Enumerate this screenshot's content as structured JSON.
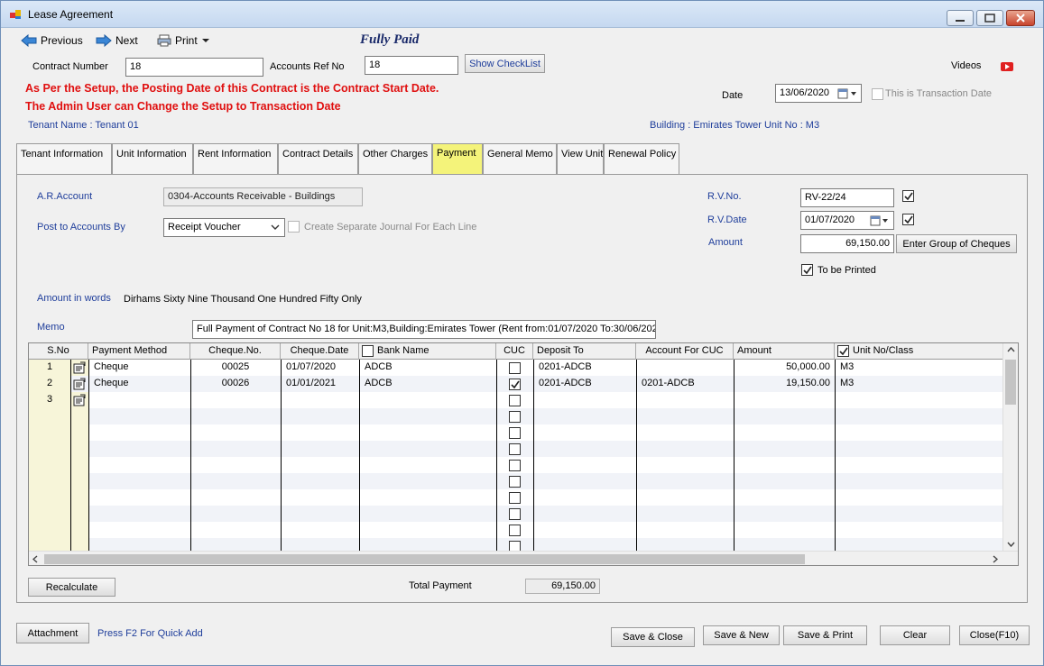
{
  "window": {
    "title": "Lease Agreement"
  },
  "toolbar": {
    "previous": "Previous",
    "next": "Next",
    "print": "Print",
    "status": "Fully Paid"
  },
  "header": {
    "contract_number_label": "Contract Number",
    "contract_number": "18",
    "accounts_ref_label": "Accounts Ref No",
    "accounts_ref": "18",
    "checklist_button": "Show CheckList",
    "videos": "Videos",
    "warning_line1": "As Per the Setup, the Posting Date of this Contract is the Contract Start Date.",
    "warning_line2": "The Admin User can Change the Setup to Transaction Date",
    "date_label": "Date",
    "date": "13/06/2020",
    "transaction_date_label": "This is Transaction Date",
    "tenant": "Tenant Name : Tenant 01",
    "building": "Building : Emirates Tower  Unit No : M3"
  },
  "tabs": [
    "Tenant Information",
    "Unit Information",
    "Rent Information",
    "Contract Details",
    "Other Charges",
    "Payment",
    "General Memo",
    "View Unit",
    "Renewal Policy"
  ],
  "payment": {
    "ar_account_label": "A.R.Account",
    "ar_account": "0304-Accounts Receivable - Buildings",
    "post_by_label": "Post to Accounts By",
    "post_by": "Receipt Voucher",
    "separate_journal_label": "Create Separate Journal For Each Line",
    "rv_no_label": "R.V.No.",
    "rv_no": "RV-22/24",
    "rv_date_label": "R.V.Date",
    "rv_date": "01/07/2020",
    "amount_label": "Amount",
    "amount": "69,150.00",
    "cheques_button": "Enter Group of Cheques",
    "to_be_printed_label": "To be Printed",
    "amount_words_label": "Amount in words",
    "amount_words": "Dirhams  Sixty Nine Thousand  One Hundred  Fifty Only",
    "memo_label": "Memo",
    "memo": "Full Payment of Contract No 18 for Unit:M3,Building:Emirates Tower (Rent from:01/07/2020 To:30/06/202",
    "recalculate": "Recalculate",
    "total_payment_label": "Total Payment",
    "total_payment": "69,150.00"
  },
  "grid": {
    "columns": [
      "S.No",
      "Payment Method",
      "Cheque.No.",
      "Cheque.Date",
      "Bank Name",
      "CUC",
      "Deposit To",
      "Account For CUC",
      "Amount",
      "Unit No/Class"
    ],
    "rows": [
      {
        "sno": "1",
        "method": "Cheque",
        "cheque_no": "00025",
        "cheque_date": "01/07/2020",
        "bank": "ADCB",
        "cuc": false,
        "deposit_to": "0201-ADCB",
        "account_cuc": "",
        "amount": "50,000.00",
        "unit": "M3"
      },
      {
        "sno": "2",
        "method": "Cheque",
        "cheque_no": "00026",
        "cheque_date": "01/01/2021",
        "bank": "ADCB",
        "cuc": true,
        "deposit_to": "0201-ADCB",
        "account_cuc": "0201-ADCB",
        "amount": "19,150.00",
        "unit": "M3"
      },
      {
        "sno": "3",
        "method": "",
        "cheque_no": "",
        "cheque_date": "",
        "bank": "",
        "cuc": false,
        "deposit_to": "",
        "account_cuc": "",
        "amount": "",
        "unit": ""
      }
    ]
  },
  "footer": {
    "attachment": "Attachment",
    "quick_add_hint": "Press F2 For Quick Add",
    "save_close": "Save & Close",
    "save_new": "Save & New",
    "save_print": "Save & Print",
    "clear": "Clear",
    "close": "Close(F10)"
  },
  "colors": {
    "active_tab": "#f4f37a",
    "warning": "#e01010",
    "label_blue": "#1f3e9b"
  }
}
